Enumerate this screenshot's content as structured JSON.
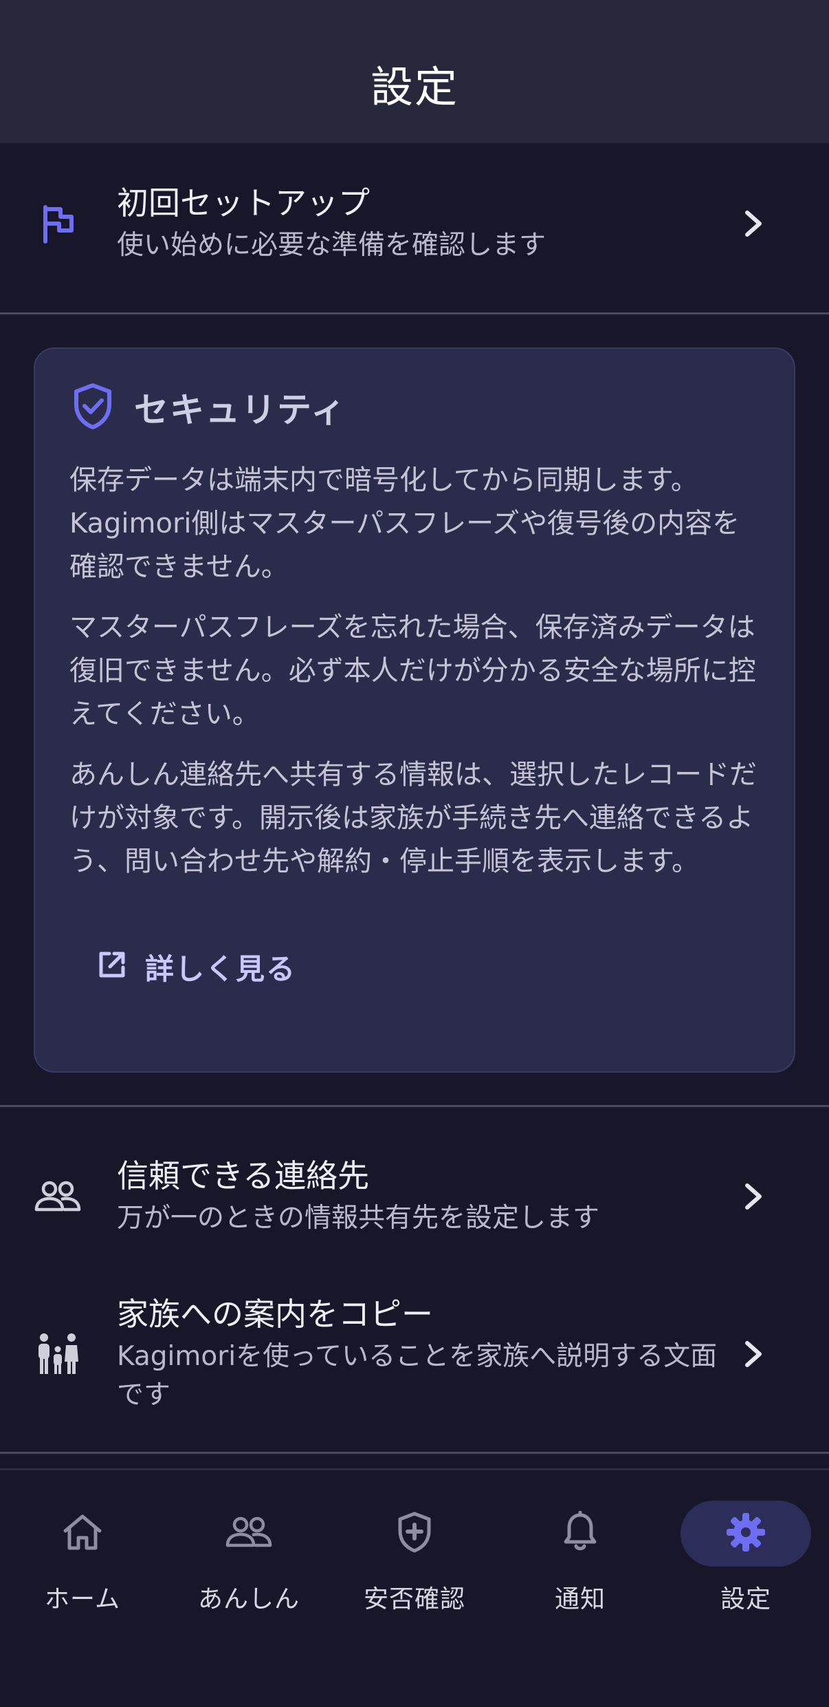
{
  "header": {
    "title": "設定"
  },
  "setup_item": {
    "icon": "flag-icon",
    "title": "初回セットアップ",
    "subtitle": "使い始めに必要な準備を確認します"
  },
  "security_card": {
    "icon": "shield-check-icon",
    "title": "セキュリティ",
    "paragraphs": [
      "保存データは端末内で暗号化してから同期します。Kagimori側はマスターパスフレーズや復号後の内容を確認できません。",
      "マスターパスフレーズを忘れた場合、保存済みデータは復旧できません。必ず本人だけが分かる安全な場所に控えてください。",
      "あんしん連絡先へ共有する情報は、選択したレコードだけが対象です。開示後は家族が手続き先へ連絡できるよう、問い合わせ先や解約・停止手順を表示します。"
    ],
    "link_icon": "open-in-new-icon",
    "link_label": "詳しく見る"
  },
  "contacts_item": {
    "icon": "people-icon",
    "title": "信頼できる連絡先",
    "subtitle": "万が一のときの情報共有先を設定します"
  },
  "family_item": {
    "icon": "family-icon",
    "title": "家族への案内をコピー",
    "subtitle": "Kagimoriを使っていることを家族へ説明する文面です"
  },
  "bottom_nav": {
    "items": [
      {
        "label": "ホーム",
        "icon": "home-icon"
      },
      {
        "label": "あんしん",
        "icon": "people-icon"
      },
      {
        "label": "安否確認",
        "icon": "shield-plus-icon"
      },
      {
        "label": "通知",
        "icon": "bell-icon"
      },
      {
        "label": "設定",
        "icon": "gear-icon",
        "active": true
      }
    ]
  },
  "colors": {
    "accent": "#6e6ef2",
    "background": "#171729",
    "header": "#28283c",
    "card": "#2b2b4b"
  }
}
